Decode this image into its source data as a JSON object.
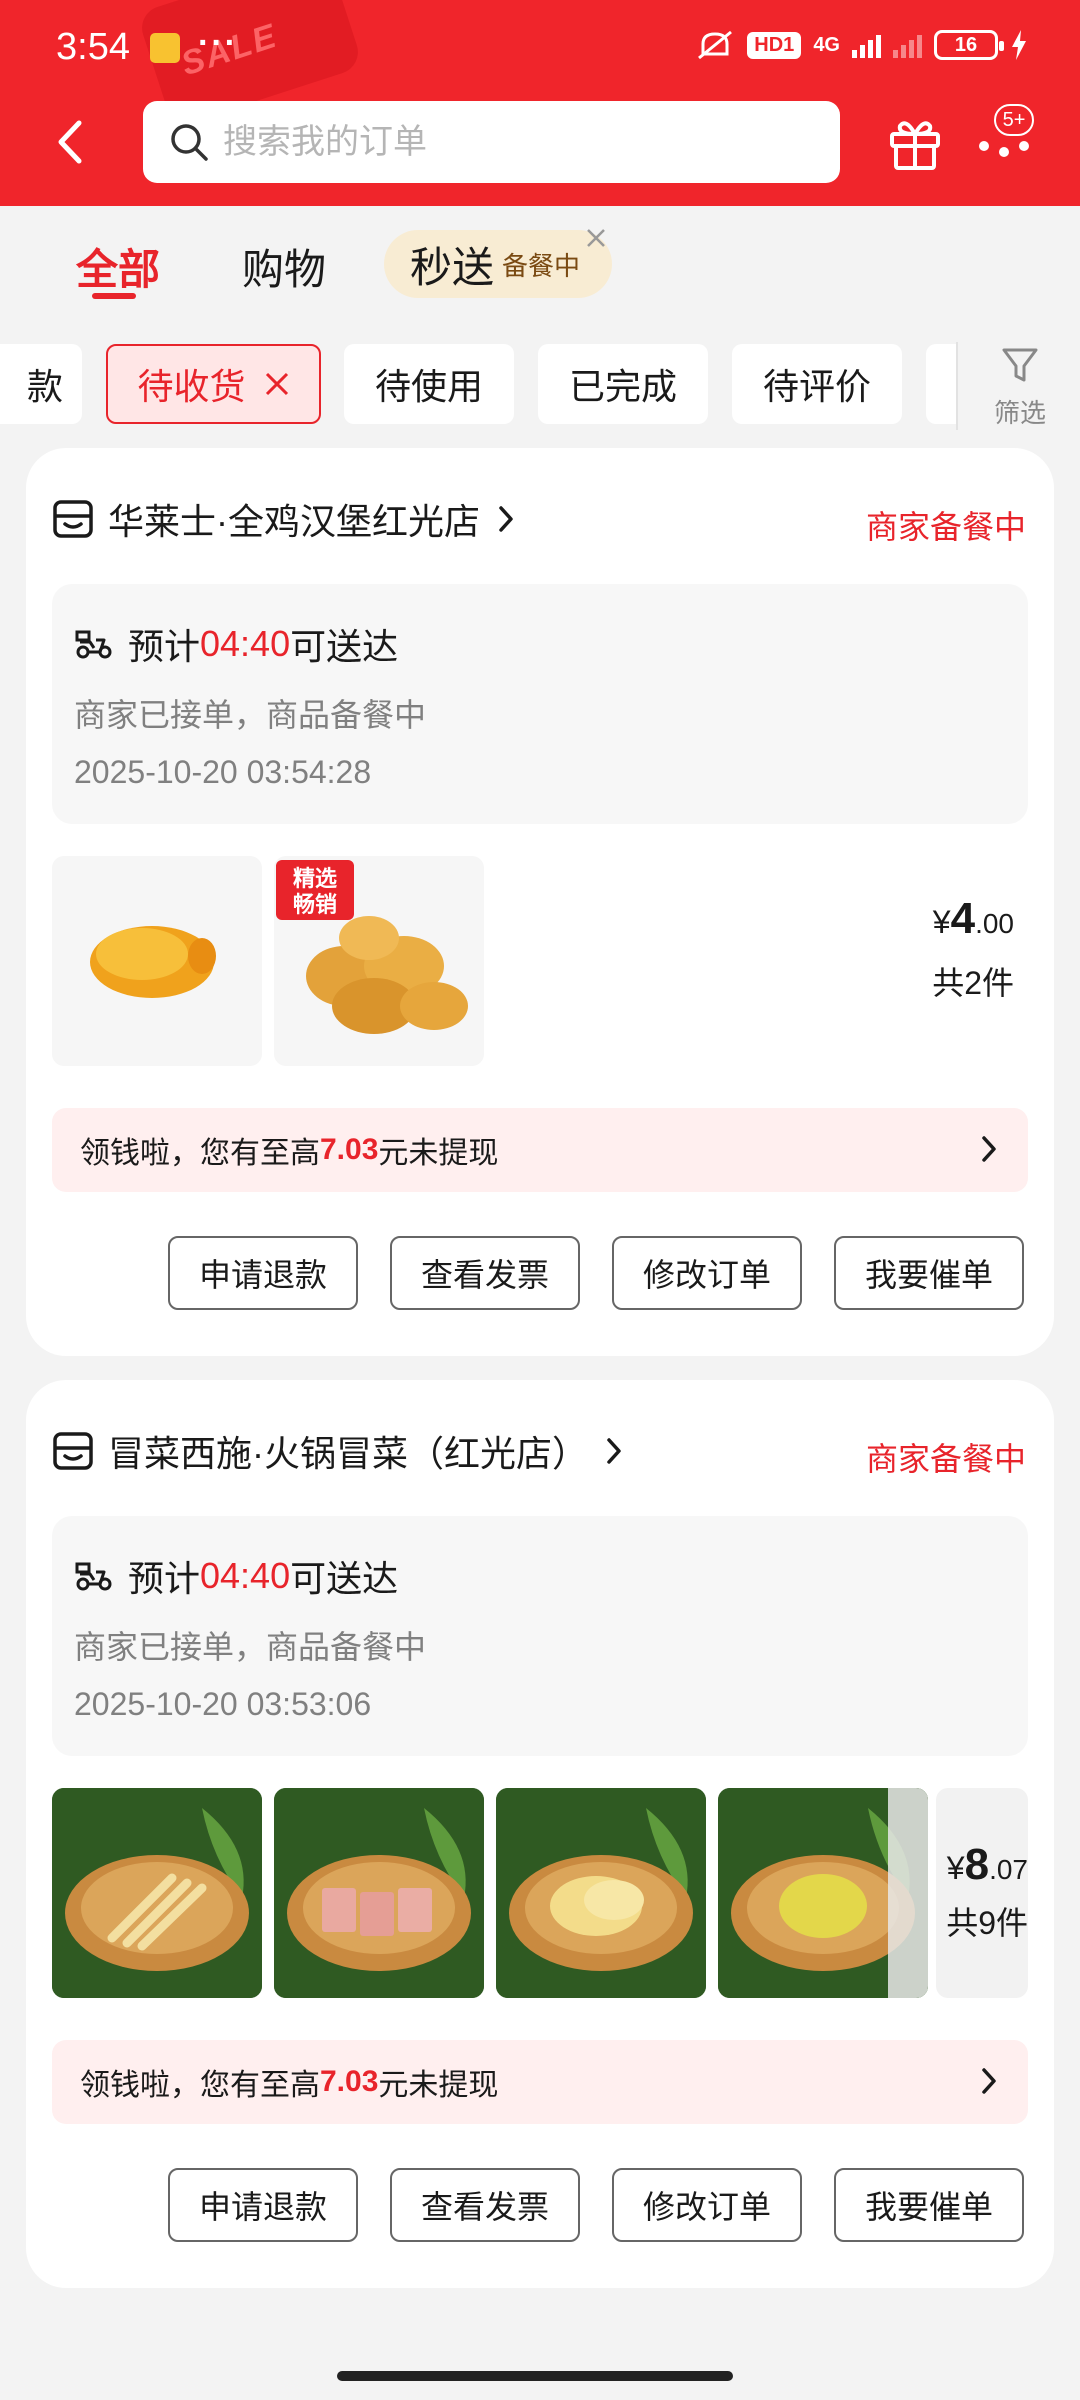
{
  "status_bar": {
    "time": "3:54",
    "dots": "···",
    "hd_badge": "HD1",
    "network": "4G",
    "battery": "16",
    "sale_deco": "SALE"
  },
  "header": {
    "search_placeholder": "搜索我的订单",
    "more_badge": "5+",
    "icons": [
      "back-chevron-icon",
      "search-icon",
      "gift-icon",
      "more-dots-icon"
    ]
  },
  "tabs": {
    "all": "全部",
    "shopping": "购物",
    "miaosong": "秒送",
    "miaosong_sub": "备餐中"
  },
  "filters": {
    "partial_left": "款",
    "items": [
      "待收货",
      "待使用",
      "已完成",
      "待评价"
    ],
    "filter_label": "筛选"
  },
  "orders": [
    {
      "shop": "华莱士·全鸡汉堡红光店",
      "status": "商家备餐中",
      "eta_prefix": "预计",
      "eta_time": "04:40",
      "eta_suffix": "可送达",
      "sub": "商家已接单，商品备餐中",
      "datetime": "2025-10-20 03:54:28",
      "thumb_tag_1": "精选",
      "thumb_tag_2": "畅销",
      "price_symbol": "¥",
      "price_int": "4",
      "price_dec": ".00",
      "count": "共2件",
      "promo_prefix": "领钱啦，您有至高",
      "promo_amount": "7.03",
      "promo_suffix": "元未提现",
      "actions": [
        "申请退款",
        "查看发票",
        "修改订单",
        "我要催单"
      ]
    },
    {
      "shop": "冒菜西施·火锅冒菜（红光店）",
      "status": "商家备餐中",
      "eta_prefix": "预计",
      "eta_time": "04:40",
      "eta_suffix": "可送达",
      "sub": "商家已接单，商品备餐中",
      "datetime": "2025-10-20 03:53:06",
      "price_symbol": "¥",
      "price_int": "8",
      "price_dec": ".07",
      "count": "共9件",
      "promo_prefix": "领钱啦，您有至高",
      "promo_amount": "7.03",
      "promo_suffix": "元未提现",
      "actions": [
        "申请退款",
        "查看发票",
        "修改订单",
        "我要催单"
      ]
    }
  ]
}
